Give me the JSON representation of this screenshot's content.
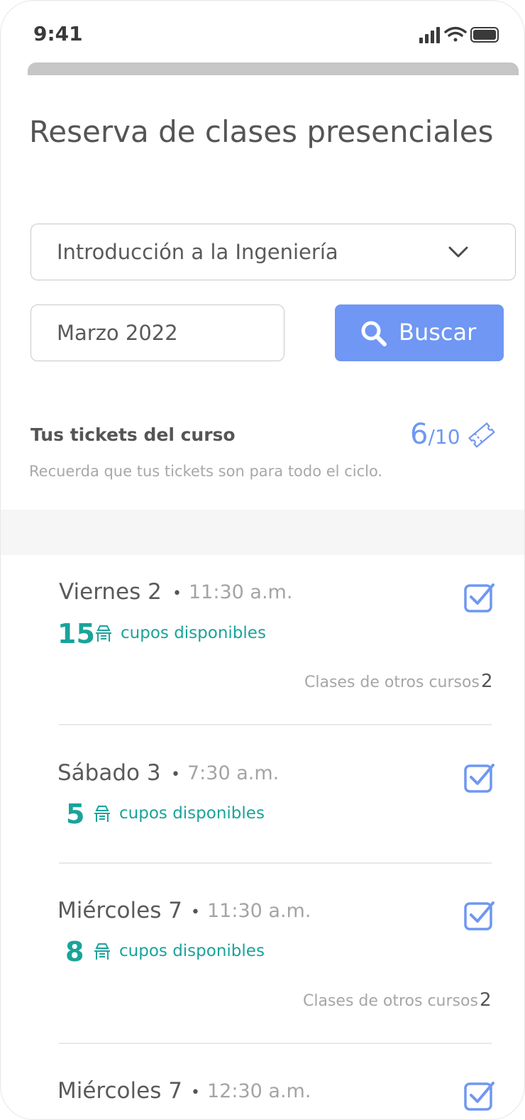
{
  "status_bar": {
    "time": "9:41",
    "icons": [
      "signal-icon",
      "wifi-icon",
      "battery-icon"
    ]
  },
  "page": {
    "title": "Reserva de clases presenciales"
  },
  "filters": {
    "course": "Introducción a la Ingeniería",
    "month": "Marzo 2022",
    "search_label": "Buscar"
  },
  "tickets": {
    "title": "Tus tickets del curso",
    "used": "6",
    "total": "/10",
    "note": "Recuerda que tus tickets son para todo el ciclo."
  },
  "classes": [
    {
      "day": "Viernes 2",
      "time": "11:30 a.m.",
      "seats": "15",
      "seats_label": "cupos disponibles",
      "others_label": "Clases de otros cursos",
      "others_count": "2"
    },
    {
      "day": "Sábado 3",
      "time": "7:30 a.m.",
      "seats": "5",
      "seats_label": "cupos disponibles"
    },
    {
      "day": "Miércoles 7",
      "time": "11:30 a.m.",
      "seats": "8",
      "seats_label": "cupos disponibles",
      "others_label": "Clases de otros cursos",
      "others_count": "2"
    },
    {
      "day": "Miércoles 7",
      "time": "12:30 a.m."
    }
  ],
  "colors": {
    "accent": "#6f97f3",
    "seats": "#1aa39a"
  }
}
